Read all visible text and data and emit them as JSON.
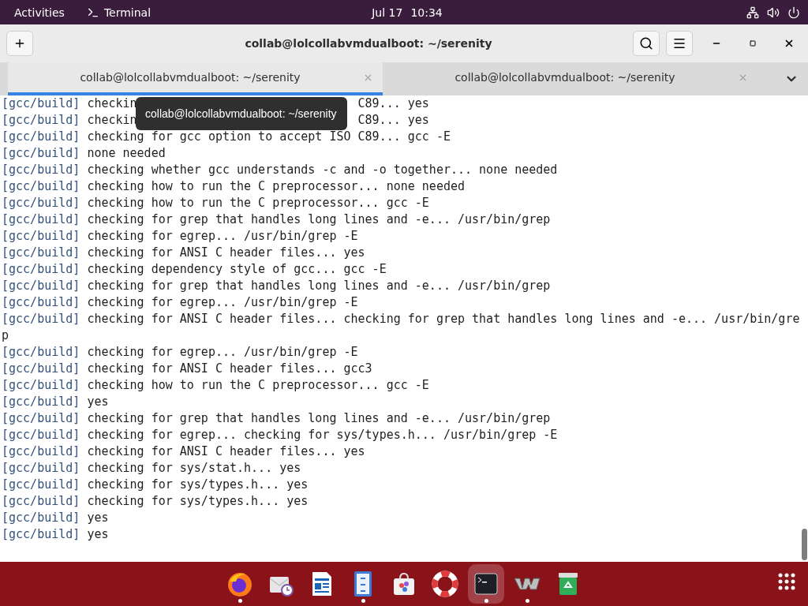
{
  "top_bar": {
    "activities": "Activities",
    "app_name": "Terminal",
    "date": "Jul 17",
    "time": "10:34"
  },
  "window": {
    "title": "collab@lolcollabvmdualboot: ~/serenity"
  },
  "tabs": [
    {
      "label": "collab@lolcollabvmdualboot: ~/serenity",
      "selected": true
    },
    {
      "label": "collab@lolcollabvmdualboot: ~/serenity",
      "selected": false
    }
  ],
  "tooltip": "collab@lolcollabvmdualboot: ~/serenity",
  "terminal": {
    "lines": [
      {
        "prefix": "[gcc/build]",
        "text": "checkin",
        "text_after": "C89... yes"
      },
      {
        "prefix": "[gcc/build]",
        "text": "checkin",
        "text_after": "C89... yes"
      },
      {
        "prefix": "[gcc/build]",
        "text": "checking for gcc option to accept ISO C89... gcc -E"
      },
      {
        "prefix": "[gcc/build]",
        "text": "none needed"
      },
      {
        "prefix": "[gcc/build]",
        "text": "checking whether gcc understands -c and -o together... none needed"
      },
      {
        "prefix": "[gcc/build]",
        "text": "checking how to run the C preprocessor... none needed"
      },
      {
        "prefix": "[gcc/build]",
        "text": "checking how to run the C preprocessor... gcc -E"
      },
      {
        "prefix": "[gcc/build]",
        "text": "checking for grep that handles long lines and -e... /usr/bin/grep"
      },
      {
        "prefix": "[gcc/build]",
        "text": "checking for egrep... /usr/bin/grep -E"
      },
      {
        "prefix": "[gcc/build]",
        "text": "checking for ANSI C header files... yes"
      },
      {
        "prefix": "[gcc/build]",
        "text": "checking dependency style of gcc... gcc -E"
      },
      {
        "prefix": "[gcc/build]",
        "text": "checking for grep that handles long lines and -e... /usr/bin/grep"
      },
      {
        "prefix": "[gcc/build]",
        "text": "checking for egrep... /usr/bin/grep -E"
      },
      {
        "prefix": "[gcc/build]",
        "text": "checking for ANSI C header files... checking for grep that handles long lines and -e... /usr/bin/gre"
      },
      {
        "text": "p"
      },
      {
        "prefix": "[gcc/build]",
        "text": "checking for egrep... /usr/bin/grep -E"
      },
      {
        "prefix": "[gcc/build]",
        "text": "checking for ANSI C header files... gcc3"
      },
      {
        "prefix": "[gcc/build]",
        "text": "checking how to run the C preprocessor... gcc -E"
      },
      {
        "prefix": "[gcc/build]",
        "text": "yes"
      },
      {
        "prefix": "[gcc/build]",
        "text": "checking for grep that handles long lines and -e... /usr/bin/grep"
      },
      {
        "prefix": "[gcc/build]",
        "text": "checking for egrep... checking for sys/types.h... /usr/bin/grep -E"
      },
      {
        "prefix": "[gcc/build]",
        "text": "checking for ANSI C header files... yes"
      },
      {
        "prefix": "[gcc/build]",
        "text": "checking for sys/stat.h... yes"
      },
      {
        "prefix": "[gcc/build]",
        "text": "checking for sys/types.h... yes"
      },
      {
        "prefix": "[gcc/build]",
        "text": "checking for sys/types.h... yes"
      },
      {
        "prefix": "[gcc/build]",
        "text": "yes"
      },
      {
        "prefix": "[gcc/build]",
        "text": "yes"
      }
    ]
  },
  "dock": {
    "items": [
      {
        "kind": "browser",
        "running": true,
        "selected": false
      },
      {
        "kind": "mail",
        "running": false,
        "selected": false
      },
      {
        "kind": "document",
        "running": false,
        "selected": false
      },
      {
        "kind": "files",
        "running": true,
        "selected": false
      },
      {
        "kind": "software",
        "running": false,
        "selected": false
      },
      {
        "kind": "help",
        "running": false,
        "selected": false
      },
      {
        "kind": "terminal",
        "running": true,
        "selected": true
      },
      {
        "kind": "vm",
        "running": true,
        "selected": false
      },
      {
        "kind": "trash",
        "running": false,
        "selected": false
      }
    ]
  }
}
